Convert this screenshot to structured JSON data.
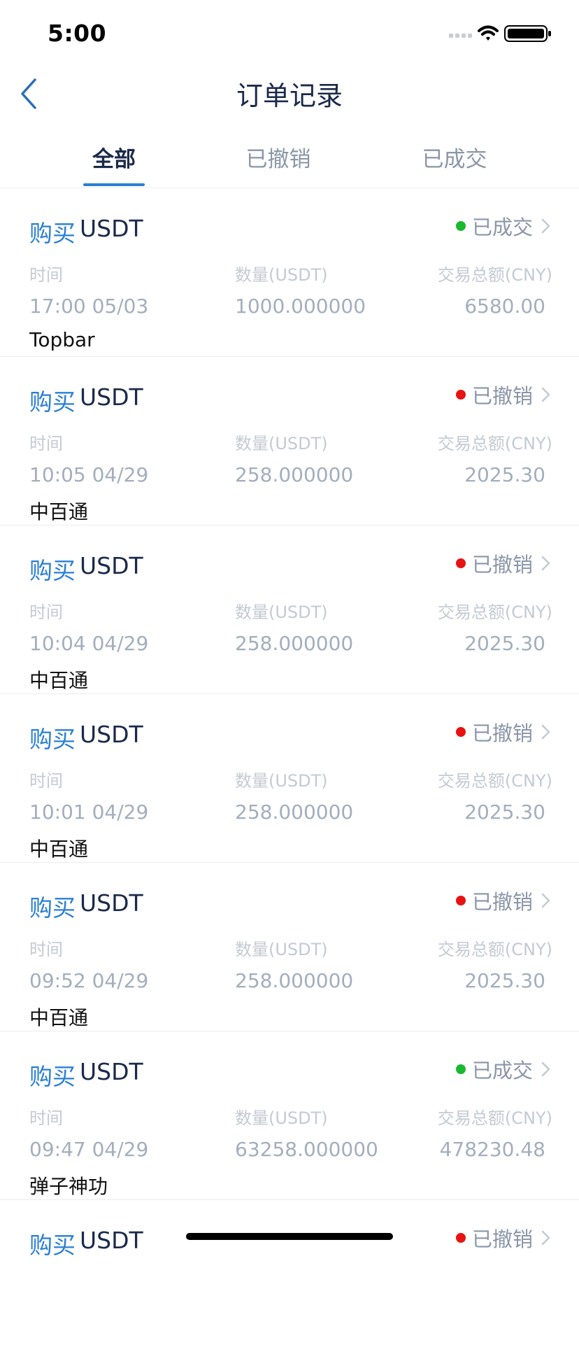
{
  "status_bar": {
    "time": "5:00"
  },
  "header": {
    "title": "订单记录",
    "back_icon": "chevron-left-icon"
  },
  "tabs": [
    {
      "label": "全部",
      "active": true
    },
    {
      "label": "已撤销",
      "active": false
    },
    {
      "label": "已成交",
      "active": false
    }
  ],
  "colors": {
    "accent": "#2a7fd4",
    "title": "#1b2a4a",
    "status_done": "#1ab82e",
    "status_cancelled": "#e81212"
  },
  "column_labels": {
    "time": "时间",
    "quantity": "数量(USDT)",
    "total": "交易总额(CNY)"
  },
  "orders": [
    {
      "action": "购买",
      "coin": "USDT",
      "status": "已成交",
      "status_type": "done",
      "time": "17:00 05/03",
      "quantity": "1000.000000",
      "total": "6580.00",
      "merchant": "Topbar"
    },
    {
      "action": "购买",
      "coin": "USDT",
      "status": "已撤销",
      "status_type": "cancelled",
      "time": "10:05 04/29",
      "quantity": "258.000000",
      "total": "2025.30",
      "merchant": "中百通"
    },
    {
      "action": "购买",
      "coin": "USDT",
      "status": "已撤销",
      "status_type": "cancelled",
      "time": "10:04 04/29",
      "quantity": "258.000000",
      "total": "2025.30",
      "merchant": "中百通"
    },
    {
      "action": "购买",
      "coin": "USDT",
      "status": "已撤销",
      "status_type": "cancelled",
      "time": "10:01 04/29",
      "quantity": "258.000000",
      "total": "2025.30",
      "merchant": "中百通"
    },
    {
      "action": "购买",
      "coin": "USDT",
      "status": "已撤销",
      "status_type": "cancelled",
      "time": "09:52 04/29",
      "quantity": "258.000000",
      "total": "2025.30",
      "merchant": "中百通"
    },
    {
      "action": "购买",
      "coin": "USDT",
      "status": "已成交",
      "status_type": "done",
      "time": "09:47 04/29",
      "quantity": "63258.000000",
      "total": "478230.48",
      "merchant": "弹子神功"
    },
    {
      "action": "购买",
      "coin": "USDT",
      "status": "已撤销",
      "status_type": "cancelled"
    }
  ]
}
